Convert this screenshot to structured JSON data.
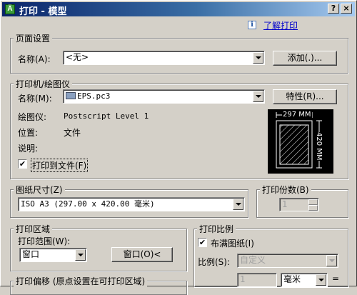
{
  "titlebar": {
    "app_icon": "Ä",
    "title": "打印 - 模型",
    "help_button": "?",
    "close_button": "×"
  },
  "help_link": {
    "icon": "i",
    "label": "了解打印"
  },
  "page_setup": {
    "title": "页面设置",
    "name_label": "名称(A):",
    "name_value": "<无>",
    "add_button": "添加(.)..."
  },
  "printer": {
    "title": "打印机/绘图仪",
    "name_label": "名称(M):",
    "name_value": "EPS.pc3",
    "properties_button": "特性(R)...",
    "plotter_label": "绘图仪:",
    "plotter_value": "Postscript Level 1",
    "location_label": "位置:",
    "location_value": "文件",
    "description_label": "说明:",
    "print_to_file_label": "打印到文件(F)",
    "print_to_file_checked": true,
    "preview_width_label": "297 MM",
    "preview_height_label": "420 MM"
  },
  "paper_size": {
    "title": "图纸尺寸(Z)",
    "value": "ISO A3 (297.00 x 420.00 毫米)"
  },
  "copies": {
    "title": "打印份数(B)",
    "value": "1"
  },
  "plot_area": {
    "title": "打印区域",
    "range_label": "打印范围(W):",
    "range_value": "窗口",
    "window_button": "窗口(O)<"
  },
  "plot_scale": {
    "title": "打印比例",
    "fit_label": "布满图纸(I)",
    "fit_checked": true,
    "scale_label": "比例(S):",
    "scale_value": "自定义",
    "units_value": "1",
    "units_select": "毫米",
    "units_equals": "="
  },
  "plot_offset": {
    "title": "打印偏移 (原点设置在可打印区域)"
  }
}
